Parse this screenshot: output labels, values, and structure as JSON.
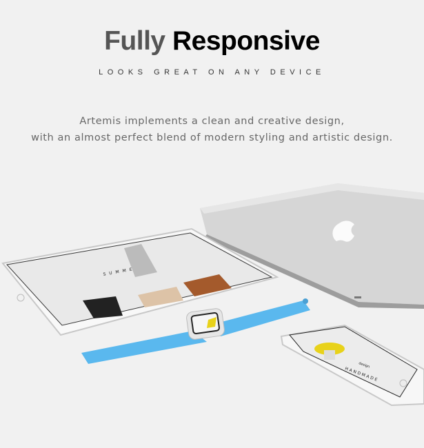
{
  "header": {
    "title_light": "Fully",
    "title_bold": "Responsive",
    "subtitle": "LOOKS GREAT ON ANY DEVICE",
    "description_line1": "Artemis implements a clean and creative design,",
    "description_line2": "with an almost perfect blend of modern styling and artistic design."
  },
  "devices": {
    "tablet_screen_text": "SUMMER",
    "phone_screen_text": "HANDMADE",
    "phone_screen_subtext": "design"
  },
  "colors": {
    "background": "#f1f1f1",
    "watch_band": "#5ab8ee",
    "laptop": "#c8c8c8",
    "hat_yellow": "#e8d21a"
  }
}
